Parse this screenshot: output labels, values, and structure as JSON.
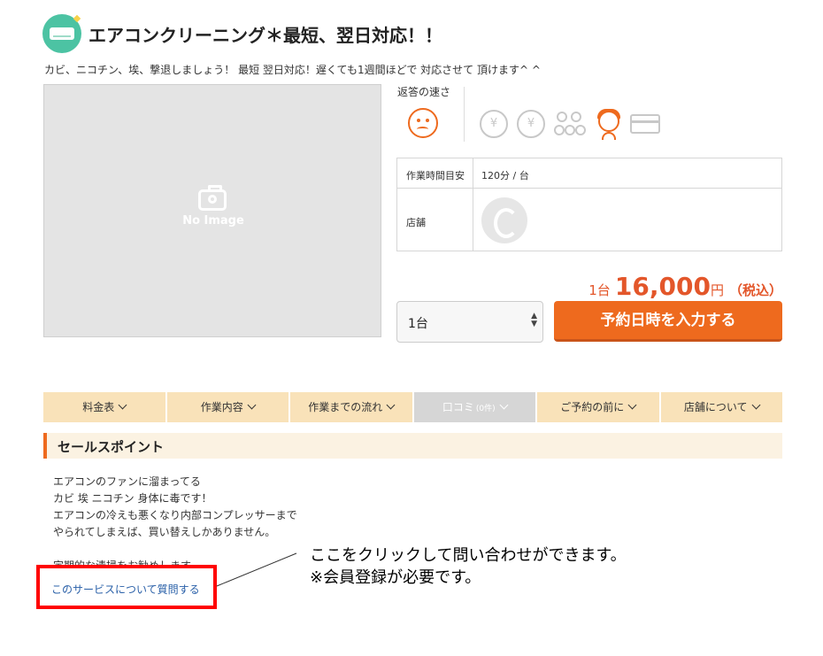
{
  "header": {
    "title": "エアコンクリーニング＊最短、翌日対応！！",
    "subtitle": "カビ、ニコチン、埃、撃退しましょう！ 最短 翌日対応！遅くても1週間ほどで 対応させて 頂けます^ ^",
    "icon": "air-conditioner-icon"
  },
  "image": {
    "placeholder_text": "No Image",
    "icon": "camera-icon"
  },
  "response_speed": {
    "label": "返答の速さ",
    "icon": "sad-face-icon"
  },
  "features": {
    "icons": [
      "yen-coin-download-icon",
      "yen-coin-lock-icon",
      "people-group-icon",
      "staff-woman-icon",
      "credit-card-icon"
    ],
    "yen_glyph": "¥"
  },
  "info": {
    "work_time_label": "作業時間目安",
    "work_time_value": "120分 / 台",
    "store_label": "店舗"
  },
  "price": {
    "unit": "1台",
    "amount": "16,000",
    "currency": "円",
    "tax": "（税込）"
  },
  "quantity": {
    "selected": "1台"
  },
  "reserve_button": "予約日時を入力する",
  "tabs": [
    {
      "label": "料金表",
      "enabled": true
    },
    {
      "label": "作業内容",
      "enabled": true
    },
    {
      "label": "作業までの流れ",
      "enabled": true
    },
    {
      "label": "口コミ",
      "count": "(0件)",
      "enabled": false
    },
    {
      "label": "ご予約の前に",
      "enabled": true
    },
    {
      "label": "店舗について",
      "enabled": true
    }
  ],
  "sales": {
    "heading": "セールスポイント",
    "lines": [
      "エアコンのファンに溜まってる",
      "カビ 埃 ニコチン 身体に毒です！",
      "エアコンの冷えも悪くなり内部コンプレッサーまで",
      "やられてしまえば、買い替えしかありません。"
    ],
    "partial_line": "定期的な清掃をお勧めします。",
    "question_link": "このサービスについて質問する"
  },
  "annotation": {
    "line1": "ここをクリックして問い合わせができます。",
    "line2": "※会員登録が必要です。",
    "highlight_color": "#ff0000"
  },
  "colors": {
    "accent": "#ee6a1e",
    "price": "#e3562a",
    "tab_bg": "#f9e2b9",
    "link": "#2a60a8"
  }
}
